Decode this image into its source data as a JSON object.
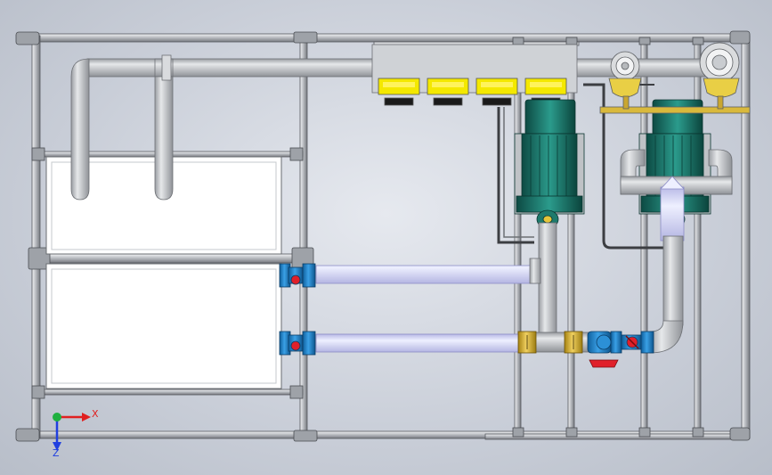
{
  "scene": {
    "description_free": true,
    "colors": {
      "background": "#d3d7df",
      "frame": "#a9adb4",
      "pipe_grey": "#c9cccf",
      "pipe_lavender": "#dadbf7",
      "valve_blue": "#1f7fc4",
      "valve_red": "#e0202a",
      "motor_teal": "#1f7a6d",
      "gold": "#d4b23a",
      "yellow_module": "#f2e600",
      "panel_white": "#ffffff"
    },
    "icons": [
      "pump-motor-icon",
      "ball-valve-icon",
      "check-valve-icon",
      "flow-meter-icon",
      "fan-icon"
    ]
  },
  "triad": {
    "x_label": "X",
    "z_label": "Z",
    "x_color": "#e02020",
    "y_color": "#1fb040",
    "z_color": "#2040e0"
  }
}
